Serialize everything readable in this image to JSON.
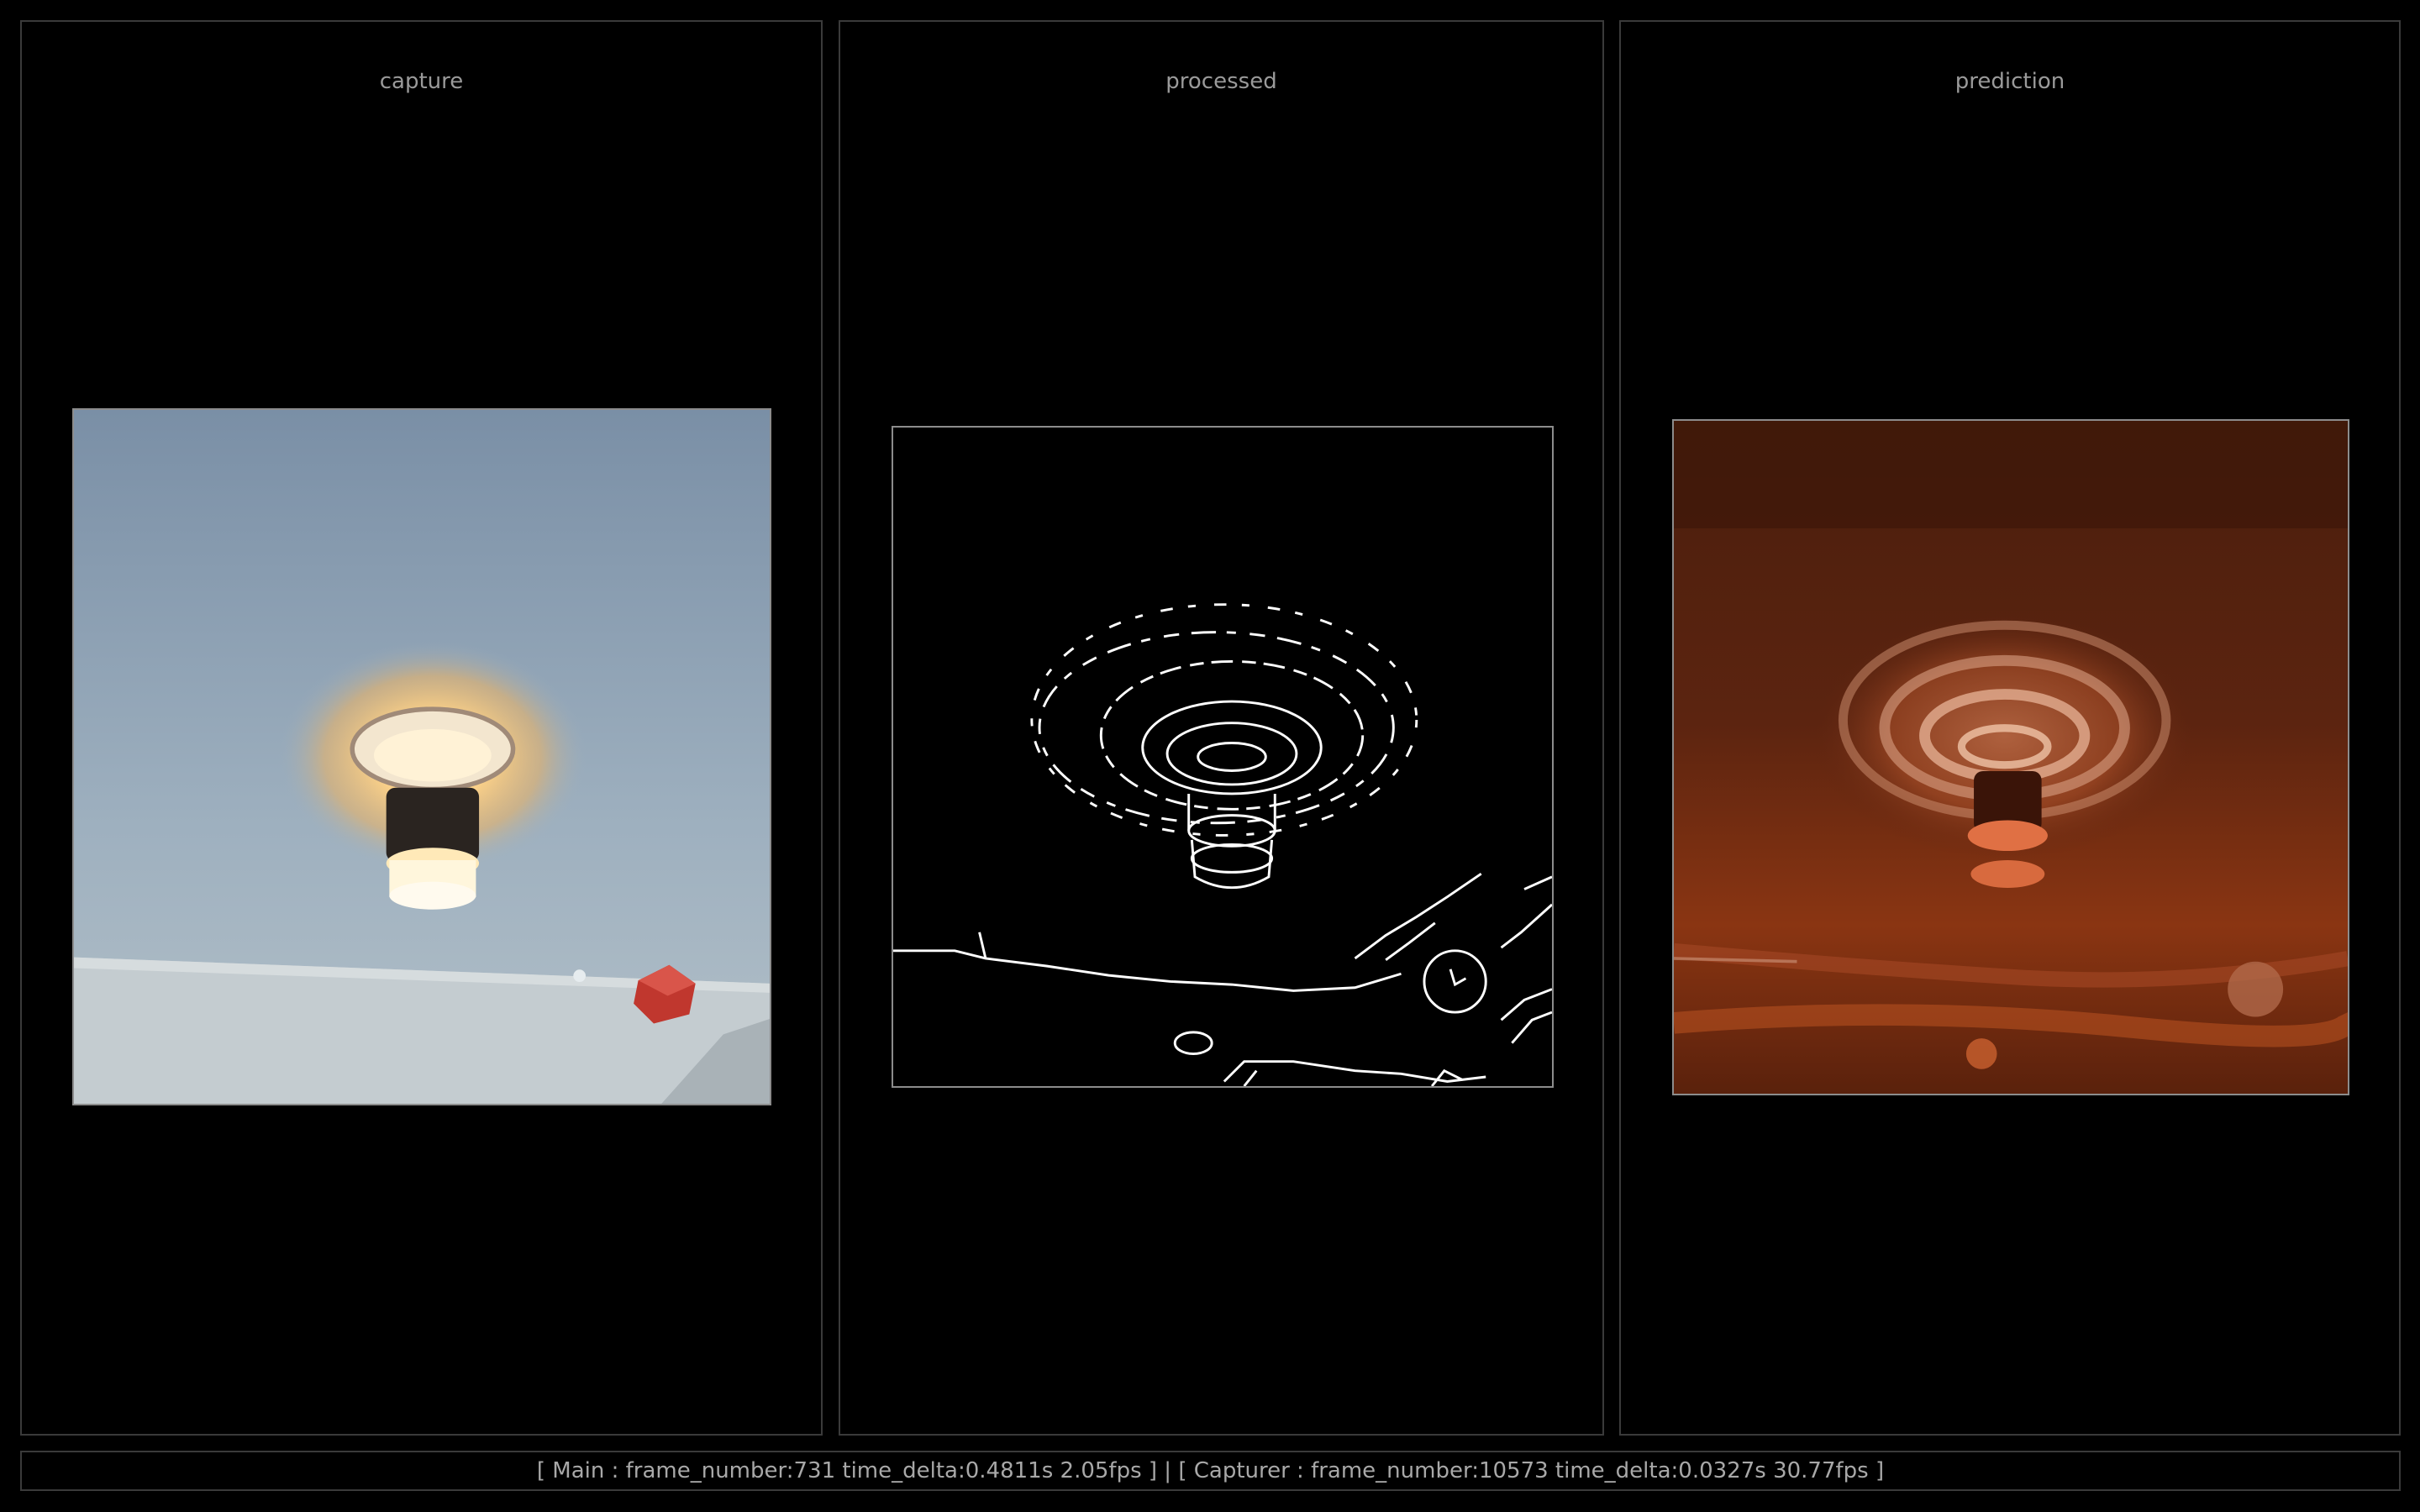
{
  "panels": {
    "capture": {
      "title": "capture"
    },
    "processed": {
      "title": "processed"
    },
    "prediction": {
      "title": "prediction"
    }
  },
  "status_bar": {
    "text": "[ Main : frame_number:731 time_delta:0.4811s 2.05fps ] | [ Capturer : frame_number:10573 time_delta:0.0327s 30.77fps ]"
  },
  "colors": {
    "background": "#000000",
    "panel_border": "#3a3a3a",
    "title_text": "#9a9a9a",
    "ceiling": "#8ea0b2",
    "lamp_glow": "#ffd89a",
    "edge_lines": "#ffffff",
    "prediction_tone": "#7a2e10"
  }
}
